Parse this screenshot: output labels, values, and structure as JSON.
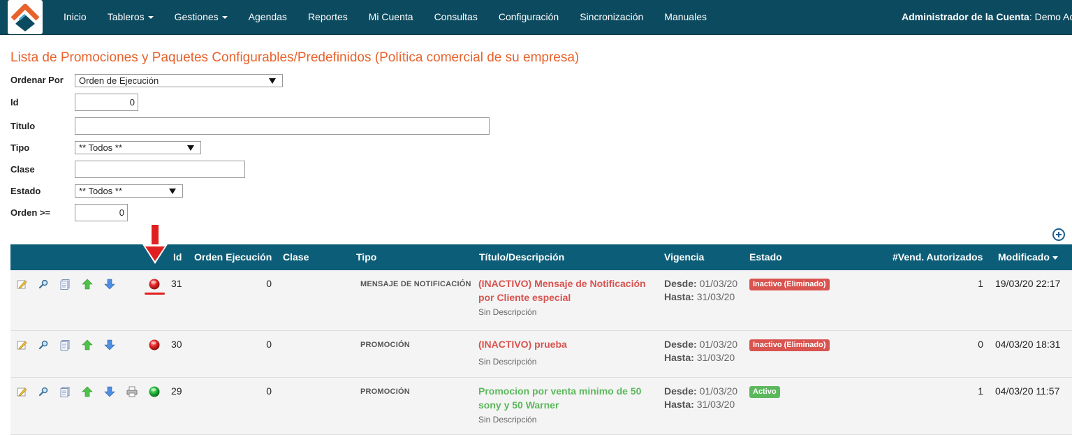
{
  "nav": {
    "items": [
      {
        "label": "Inicio",
        "dropdown": false
      },
      {
        "label": "Tableros",
        "dropdown": true
      },
      {
        "label": "Gestiones",
        "dropdown": true
      },
      {
        "label": "Agendas",
        "dropdown": false
      },
      {
        "label": "Reportes",
        "dropdown": false
      },
      {
        "label": "Mi Cuenta",
        "dropdown": false
      },
      {
        "label": "Consultas",
        "dropdown": false
      },
      {
        "label": "Configuración",
        "dropdown": false
      },
      {
        "label": "Sincronización",
        "dropdown": false
      },
      {
        "label": "Manuales",
        "dropdown": false
      }
    ],
    "account_label": "Administrador de la Cuenta",
    "account_value": ": Demo Ac"
  },
  "page": {
    "title": "Lista de Promociones y Paquetes Configurables/Predefinidos (Política comercial de su empresa)"
  },
  "filters": {
    "ordenar_por": {
      "label": "Ordenar Por",
      "value": "Orden de Ejecución"
    },
    "id": {
      "label": "Id",
      "value": "0"
    },
    "titulo": {
      "label": "Titulo",
      "value": ""
    },
    "tipo": {
      "label": "Tipo",
      "value": "** Todos **"
    },
    "clase": {
      "label": "Clase",
      "value": ""
    },
    "estado": {
      "label": "Estado",
      "value": "** Todos **"
    },
    "orden": {
      "label": "Orden >=",
      "value": "0"
    }
  },
  "table": {
    "headers": {
      "id": "Id",
      "orden": "Orden Ejecución",
      "clase": "Clase",
      "tipo": "Tipo",
      "titulo": "Título/Descripción",
      "vigencia": "Vigencia",
      "estado": "Estado",
      "vend": "#Vend. Autorizados",
      "modificado": "Modificado"
    },
    "vig_desde_label": "Desde:",
    "vig_hasta_label": "Hasta:",
    "rows": [
      {
        "id": "31",
        "orden": "0",
        "clase": "",
        "tipo": "MENSAJE DE NOTIFICACIÓN",
        "titulo_line1": "(INACTIVO) Mensaje de Notificación",
        "titulo_line2": "por Cliente especial",
        "descripcion": "Sin Descripción",
        "desde": "01/03/20",
        "hasta": "31/03/20",
        "estado": "Inactivo (Eliminado)",
        "estado_color": "#d9534f",
        "vend": "1",
        "modificado": "19/03/20 22:17",
        "status_dot": "red",
        "has_print": false
      },
      {
        "id": "30",
        "orden": "0",
        "clase": "",
        "tipo": "PROMOCIÓN",
        "titulo_line1": "(INACTIVO) prueba",
        "titulo_line2": "",
        "descripcion": "Sin Descripción",
        "desde": "01/03/20",
        "hasta": "31/03/20",
        "estado": "Inactivo (Eliminado)",
        "estado_color": "#d9534f",
        "vend": "0",
        "modificado": "04/03/20 18:31",
        "status_dot": "red",
        "has_print": false
      },
      {
        "id": "29",
        "orden": "0",
        "clase": "",
        "tipo": "PROMOCIÓN",
        "titulo_line1": "Promocion por venta minimo de 50",
        "titulo_line2": "sony y 50 Warner",
        "descripcion": "Sin Descripción",
        "desde": "01/03/20",
        "hasta": "31/03/20",
        "estado": "Activo",
        "estado_color": "#5cb85c",
        "vend": "1",
        "modificado": "04/03/20 11:57",
        "status_dot": "green",
        "has_print": true
      }
    ]
  },
  "colors": {
    "navbar": "#0c4a5f",
    "table_header": "#0c5e78",
    "title": "#e8622c",
    "inactive": "#d9534f",
    "active": "#5cb85c",
    "annotation": "#e02020"
  },
  "icons": [
    "edit-icon",
    "search-icon",
    "copy-icon",
    "arrow-up-icon",
    "arrow-down-icon",
    "print-icon",
    "status-dot-icon",
    "add-icon"
  ]
}
